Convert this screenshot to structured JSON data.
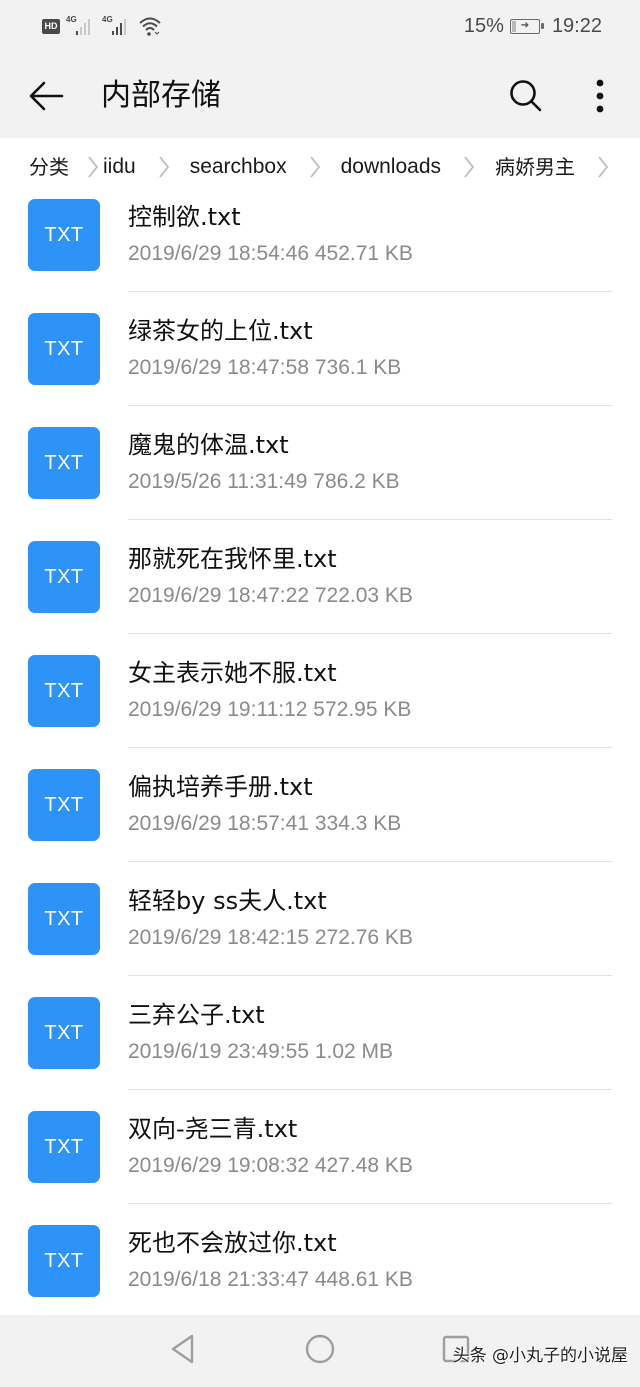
{
  "status_bar": {
    "hd_label": "HD",
    "sim1_label": "4G",
    "sim2_label": "4G",
    "battery_percent_text": "15%",
    "battery_level": 0.15,
    "battery_charging": true,
    "time": "19:22"
  },
  "app_bar": {
    "back_icon": "arrow-left-icon",
    "title": "内部存储",
    "search_icon": "search-icon",
    "more_icon": "more-vertical-icon"
  },
  "breadcrumb": {
    "items": [
      {
        "label": "分类"
      },
      {
        "label": "iidu"
      },
      {
        "label": "searchbox"
      },
      {
        "label": "downloads"
      },
      {
        "label": "病娇男主"
      }
    ],
    "separator_icon": "chevron-right-icon"
  },
  "files": [
    {
      "type_badge": "TXT",
      "name": "控制欲.txt",
      "meta": "2019/6/29 18:54:46 452.71 KB"
    },
    {
      "type_badge": "TXT",
      "name": "绿茶女的上位.txt",
      "meta": "2019/6/29 18:47:58 736.1 KB"
    },
    {
      "type_badge": "TXT",
      "name": "魔鬼的体温.txt",
      "meta": "2019/5/26 11:31:49 786.2 KB"
    },
    {
      "type_badge": "TXT",
      "name": "那就死在我怀里.txt",
      "meta": "2019/6/29 18:47:22 722.03 KB"
    },
    {
      "type_badge": "TXT",
      "name": "女主表示她不服.txt",
      "meta": "2019/6/29 19:11:12 572.95 KB"
    },
    {
      "type_badge": "TXT",
      "name": "偏执培养手册.txt",
      "meta": "2019/6/29 18:57:41 334.3 KB"
    },
    {
      "type_badge": "TXT",
      "name": "轻轻by ss夫人.txt",
      "meta": "2019/6/29 18:42:15 272.76 KB"
    },
    {
      "type_badge": "TXT",
      "name": "三弃公子.txt",
      "meta": "2019/6/19 23:49:55 1.02 MB"
    },
    {
      "type_badge": "TXT",
      "name": "双向-尧三青.txt",
      "meta": "2019/6/29 19:08:32 427.48 KB"
    },
    {
      "type_badge": "TXT",
      "name": "死也不会放过你.txt",
      "meta": "2019/6/18 21:33:47 448.61 KB"
    }
  ],
  "nav_bar": {
    "back_icon": "triangle-back-icon",
    "home_icon": "circle-home-icon",
    "recents_icon": "square-recents-icon"
  },
  "watermark": "头条 @小丸子的小说屋",
  "colors": {
    "accent": "#2e93f6",
    "bar_background": "#f2f2f2",
    "meta_text": "#8a8a8a",
    "divider": "#e2e2e2"
  }
}
